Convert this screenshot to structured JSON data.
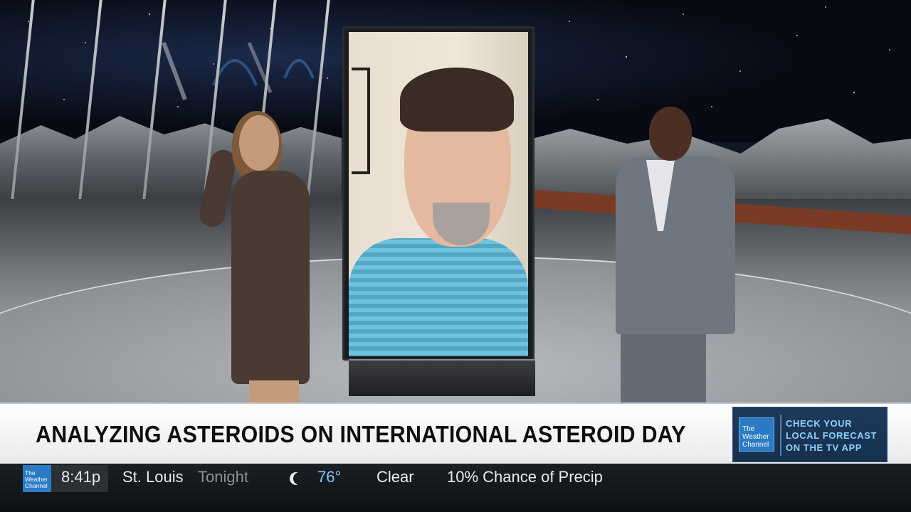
{
  "headline": {
    "text": "ANALYZING ASTEROIDS ON INTERNATIONAL ASTEROID DAY"
  },
  "promo": {
    "logo_line1": "The",
    "logo_line2": "Weather",
    "logo_line3": "Channel",
    "line1": "CHECK YOUR",
    "line2": "LOCAL FORECAST",
    "line3": "ON THE TV APP"
  },
  "ticker": {
    "logo_line1": "The",
    "logo_line2": "Weather",
    "logo_line3": "Channel",
    "time": "8:41p",
    "location": "St. Louis",
    "period": "Tonight",
    "icon": "moon-icon",
    "temperature": "76°",
    "condition": "Clear",
    "precip": "10% Chance of Precip"
  },
  "colors": {
    "promo_text": "#8fd0ff",
    "temp_text": "#7fc8ff",
    "brand_blue": "#2a7bc4"
  }
}
